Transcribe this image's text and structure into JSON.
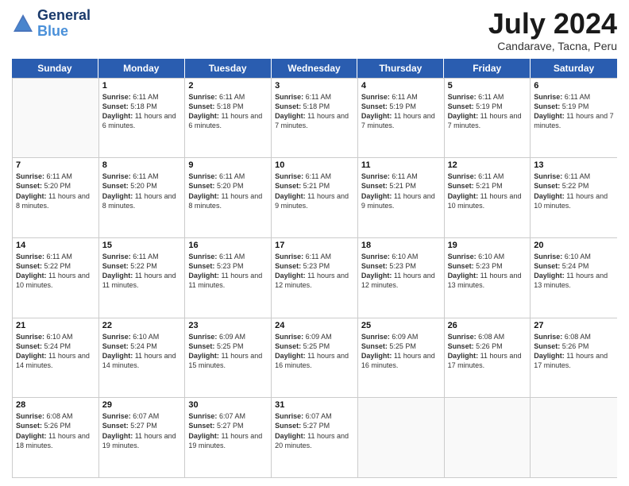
{
  "header": {
    "logo_line1": "General",
    "logo_line2": "Blue",
    "title": "July 2024",
    "subtitle": "Candarave, Tacna, Peru"
  },
  "days_of_week": [
    "Sunday",
    "Monday",
    "Tuesday",
    "Wednesday",
    "Thursday",
    "Friday",
    "Saturday"
  ],
  "weeks": [
    [
      {
        "day": "",
        "sunrise": "",
        "sunset": "",
        "daylight": ""
      },
      {
        "day": "1",
        "sunrise": "6:11 AM",
        "sunset": "5:18 PM",
        "daylight": "11 hours and 6 minutes."
      },
      {
        "day": "2",
        "sunrise": "6:11 AM",
        "sunset": "5:18 PM",
        "daylight": "11 hours and 6 minutes."
      },
      {
        "day": "3",
        "sunrise": "6:11 AM",
        "sunset": "5:18 PM",
        "daylight": "11 hours and 7 minutes."
      },
      {
        "day": "4",
        "sunrise": "6:11 AM",
        "sunset": "5:19 PM",
        "daylight": "11 hours and 7 minutes."
      },
      {
        "day": "5",
        "sunrise": "6:11 AM",
        "sunset": "5:19 PM",
        "daylight": "11 hours and 7 minutes."
      },
      {
        "day": "6",
        "sunrise": "6:11 AM",
        "sunset": "5:19 PM",
        "daylight": "11 hours and 7 minutes."
      }
    ],
    [
      {
        "day": "7",
        "sunrise": "6:11 AM",
        "sunset": "5:20 PM",
        "daylight": "11 hours and 8 minutes."
      },
      {
        "day": "8",
        "sunrise": "6:11 AM",
        "sunset": "5:20 PM",
        "daylight": "11 hours and 8 minutes."
      },
      {
        "day": "9",
        "sunrise": "6:11 AM",
        "sunset": "5:20 PM",
        "daylight": "11 hours and 8 minutes."
      },
      {
        "day": "10",
        "sunrise": "6:11 AM",
        "sunset": "5:21 PM",
        "daylight": "11 hours and 9 minutes."
      },
      {
        "day": "11",
        "sunrise": "6:11 AM",
        "sunset": "5:21 PM",
        "daylight": "11 hours and 9 minutes."
      },
      {
        "day": "12",
        "sunrise": "6:11 AM",
        "sunset": "5:21 PM",
        "daylight": "11 hours and 10 minutes."
      },
      {
        "day": "13",
        "sunrise": "6:11 AM",
        "sunset": "5:22 PM",
        "daylight": "11 hours and 10 minutes."
      }
    ],
    [
      {
        "day": "14",
        "sunrise": "6:11 AM",
        "sunset": "5:22 PM",
        "daylight": "11 hours and 10 minutes."
      },
      {
        "day": "15",
        "sunrise": "6:11 AM",
        "sunset": "5:22 PM",
        "daylight": "11 hours and 11 minutes."
      },
      {
        "day": "16",
        "sunrise": "6:11 AM",
        "sunset": "5:23 PM",
        "daylight": "11 hours and 11 minutes."
      },
      {
        "day": "17",
        "sunrise": "6:11 AM",
        "sunset": "5:23 PM",
        "daylight": "11 hours and 12 minutes."
      },
      {
        "day": "18",
        "sunrise": "6:10 AM",
        "sunset": "5:23 PM",
        "daylight": "11 hours and 12 minutes."
      },
      {
        "day": "19",
        "sunrise": "6:10 AM",
        "sunset": "5:23 PM",
        "daylight": "11 hours and 13 minutes."
      },
      {
        "day": "20",
        "sunrise": "6:10 AM",
        "sunset": "5:24 PM",
        "daylight": "11 hours and 13 minutes."
      }
    ],
    [
      {
        "day": "21",
        "sunrise": "6:10 AM",
        "sunset": "5:24 PM",
        "daylight": "11 hours and 14 minutes."
      },
      {
        "day": "22",
        "sunrise": "6:10 AM",
        "sunset": "5:24 PM",
        "daylight": "11 hours and 14 minutes."
      },
      {
        "day": "23",
        "sunrise": "6:09 AM",
        "sunset": "5:25 PM",
        "daylight": "11 hours and 15 minutes."
      },
      {
        "day": "24",
        "sunrise": "6:09 AM",
        "sunset": "5:25 PM",
        "daylight": "11 hours and 16 minutes."
      },
      {
        "day": "25",
        "sunrise": "6:09 AM",
        "sunset": "5:25 PM",
        "daylight": "11 hours and 16 minutes."
      },
      {
        "day": "26",
        "sunrise": "6:08 AM",
        "sunset": "5:26 PM",
        "daylight": "11 hours and 17 minutes."
      },
      {
        "day": "27",
        "sunrise": "6:08 AM",
        "sunset": "5:26 PM",
        "daylight": "11 hours and 17 minutes."
      }
    ],
    [
      {
        "day": "28",
        "sunrise": "6:08 AM",
        "sunset": "5:26 PM",
        "daylight": "11 hours and 18 minutes."
      },
      {
        "day": "29",
        "sunrise": "6:07 AM",
        "sunset": "5:27 PM",
        "daylight": "11 hours and 19 minutes."
      },
      {
        "day": "30",
        "sunrise": "6:07 AM",
        "sunset": "5:27 PM",
        "daylight": "11 hours and 19 minutes."
      },
      {
        "day": "31",
        "sunrise": "6:07 AM",
        "sunset": "5:27 PM",
        "daylight": "11 hours and 20 minutes."
      },
      {
        "day": "",
        "sunrise": "",
        "sunset": "",
        "daylight": ""
      },
      {
        "day": "",
        "sunrise": "",
        "sunset": "",
        "daylight": ""
      },
      {
        "day": "",
        "sunrise": "",
        "sunset": "",
        "daylight": ""
      }
    ]
  ]
}
